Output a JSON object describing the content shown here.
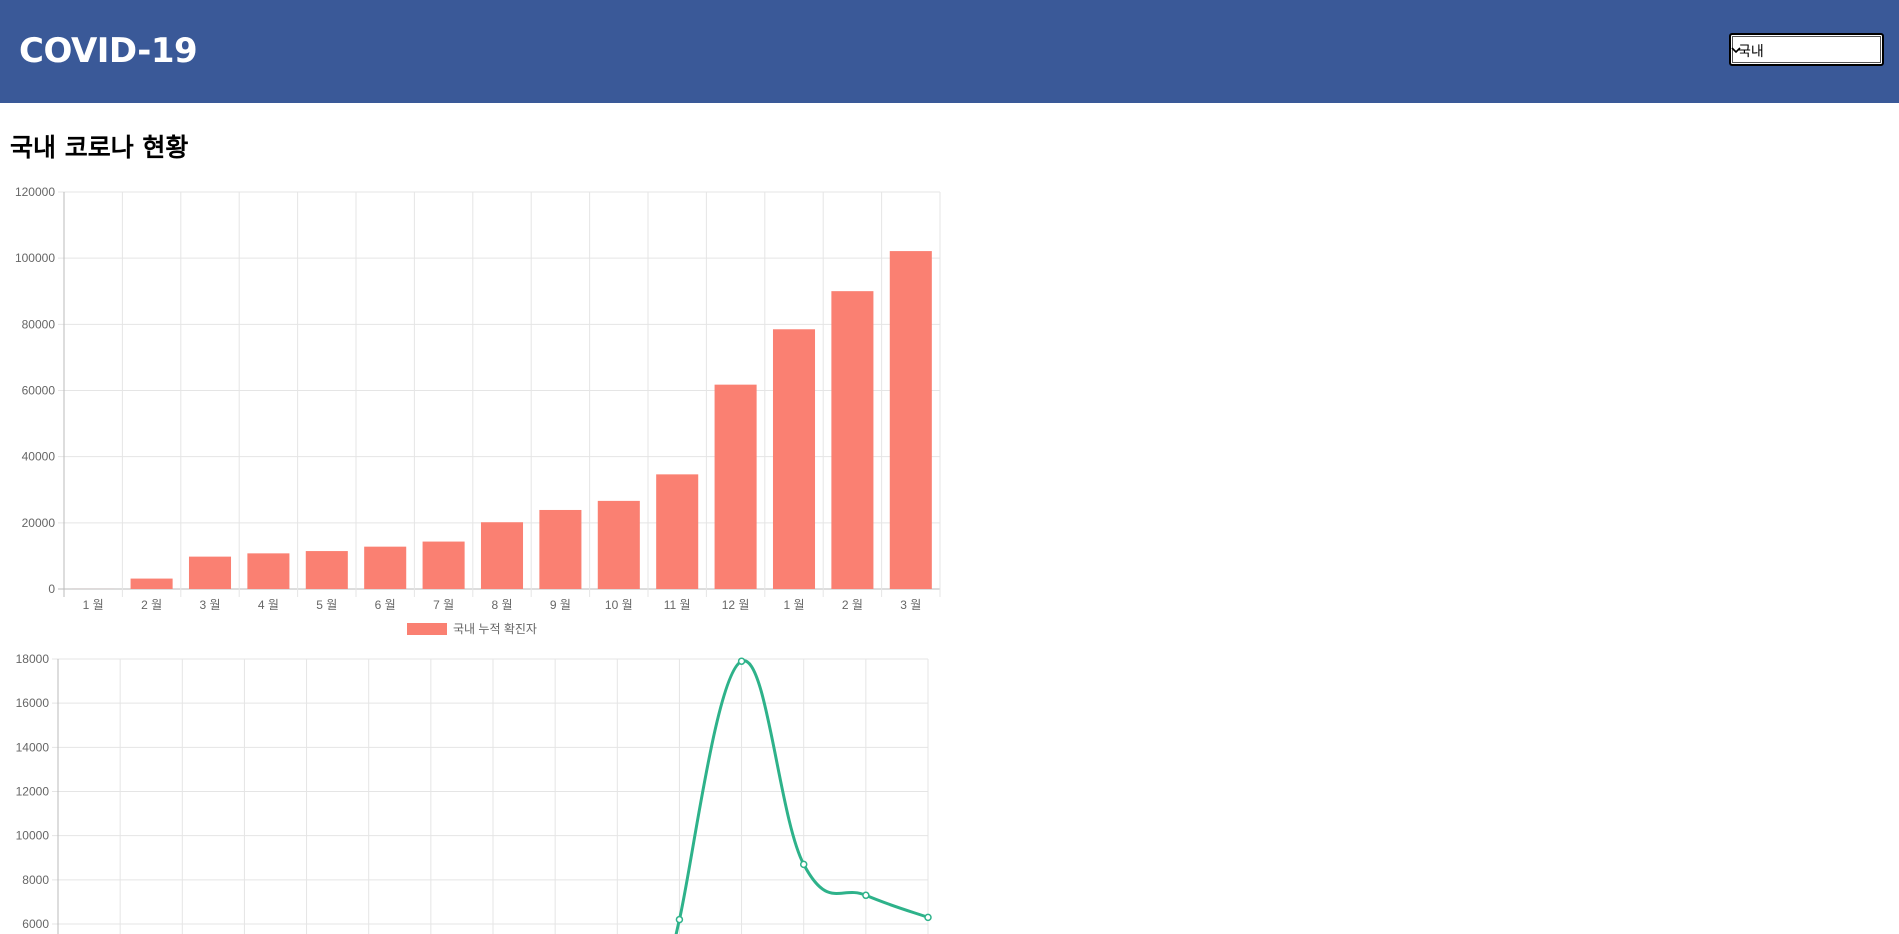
{
  "header": {
    "title": "COVID-19",
    "region_select": {
      "selected": "국내"
    },
    "background": "#3a5998"
  },
  "page_title": "국내 코로나 현황",
  "chart_data": [
    {
      "type": "bar",
      "categories": [
        "1 월",
        "2 월",
        "3 월",
        "4 월",
        "5 월",
        "6 월",
        "7 월",
        "8 월",
        "9 월",
        "10 월",
        "11 월",
        "12 월",
        "1 월",
        "2 월",
        "3 월"
      ],
      "series": [
        {
          "name": "국내 누적 확진자",
          "color": "#fa8072",
          "values": [
            11,
            3150,
            9786,
            10774,
            11468,
            12800,
            14336,
            20182,
            23889,
            26635,
            34652,
            61769,
            78508,
            90029,
            102141
          ]
        }
      ],
      "yticks": [
        0,
        20000,
        40000,
        60000,
        80000,
        100000,
        120000
      ],
      "ylim": [
        0,
        120000
      ],
      "grid": true,
      "legend": "bottom"
    },
    {
      "type": "line",
      "series": [
        {
          "color": "#2eb28a",
          "values": [
            null,
            null,
            null,
            null,
            null,
            null,
            null,
            null,
            null,
            null,
            6200,
            17900,
            8700,
            7300,
            6300
          ]
        }
      ],
      "yticks": [
        6000,
        8000,
        10000,
        12000,
        14000,
        16000,
        18000
      ],
      "ylim": [
        6000,
        18000
      ],
      "grid": true
    }
  ]
}
